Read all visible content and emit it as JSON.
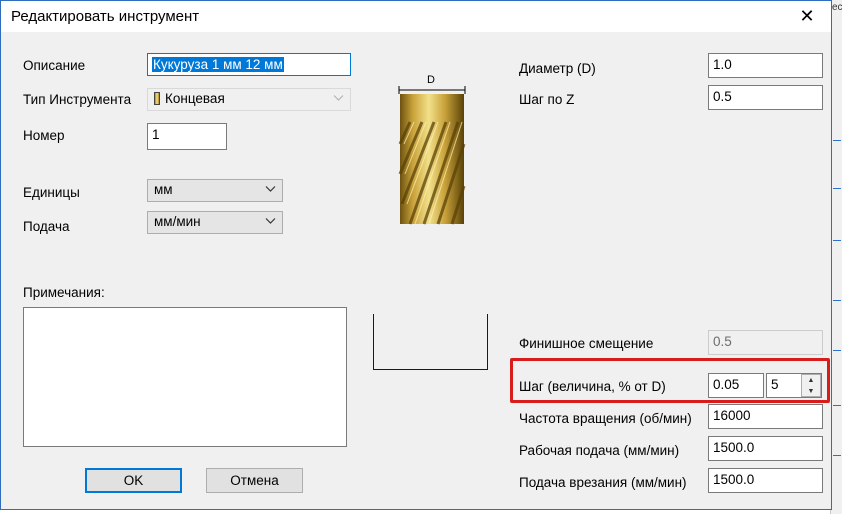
{
  "window": {
    "title": "Редактировать инструмент",
    "close_glyph": "✕"
  },
  "form_left": {
    "description_label": "Описание",
    "description_value": "Кукуруза 1 мм 12 мм",
    "tool_type_label": "Тип Инструмента",
    "tool_type_value": "Концевая",
    "number_label": "Номер",
    "number_value": "1",
    "units_label": "Единицы",
    "units_value": "мм",
    "feed_label": "Подача",
    "feed_value": "мм/мин",
    "notes_label": "Примечания:",
    "notes_value": ""
  },
  "tool_image": {
    "dimension_label": "D",
    "icon": "end-mill-tool-image",
    "colors": {
      "gold_light": "#f2e08a",
      "gold_mid": "#c9a23a",
      "gold_dark": "#6e5210"
    }
  },
  "form_right": {
    "diameter_label": "Диаметр (D)",
    "diameter_value": "1.0",
    "stepdown_label": "Шаг по Z",
    "stepdown_value": "0.5",
    "finish_offset_label": "Финишное смещение",
    "finish_offset_value": "0.5",
    "stepover_label": "Шаг (величина, % от D)",
    "stepover_value": "0.05",
    "stepover_percent": "5",
    "spindle_label": "Частота вращения (об/мин)",
    "spindle_value": "16000",
    "feedrate_label": "Рабочая подача (мм/мин)",
    "feedrate_value": "1500.0",
    "plunge_label": "Подача врезания (мм/мин)",
    "plunge_value": "1500.0"
  },
  "buttons": {
    "ok": "OK",
    "cancel": "Отмена"
  },
  "background_app": {
    "text_fragments": [
      "еская с"
    ]
  },
  "colors": {
    "highlight": "#d81b1b",
    "accent": "#0078d7",
    "dialog_bg": "#f0f0f0"
  }
}
